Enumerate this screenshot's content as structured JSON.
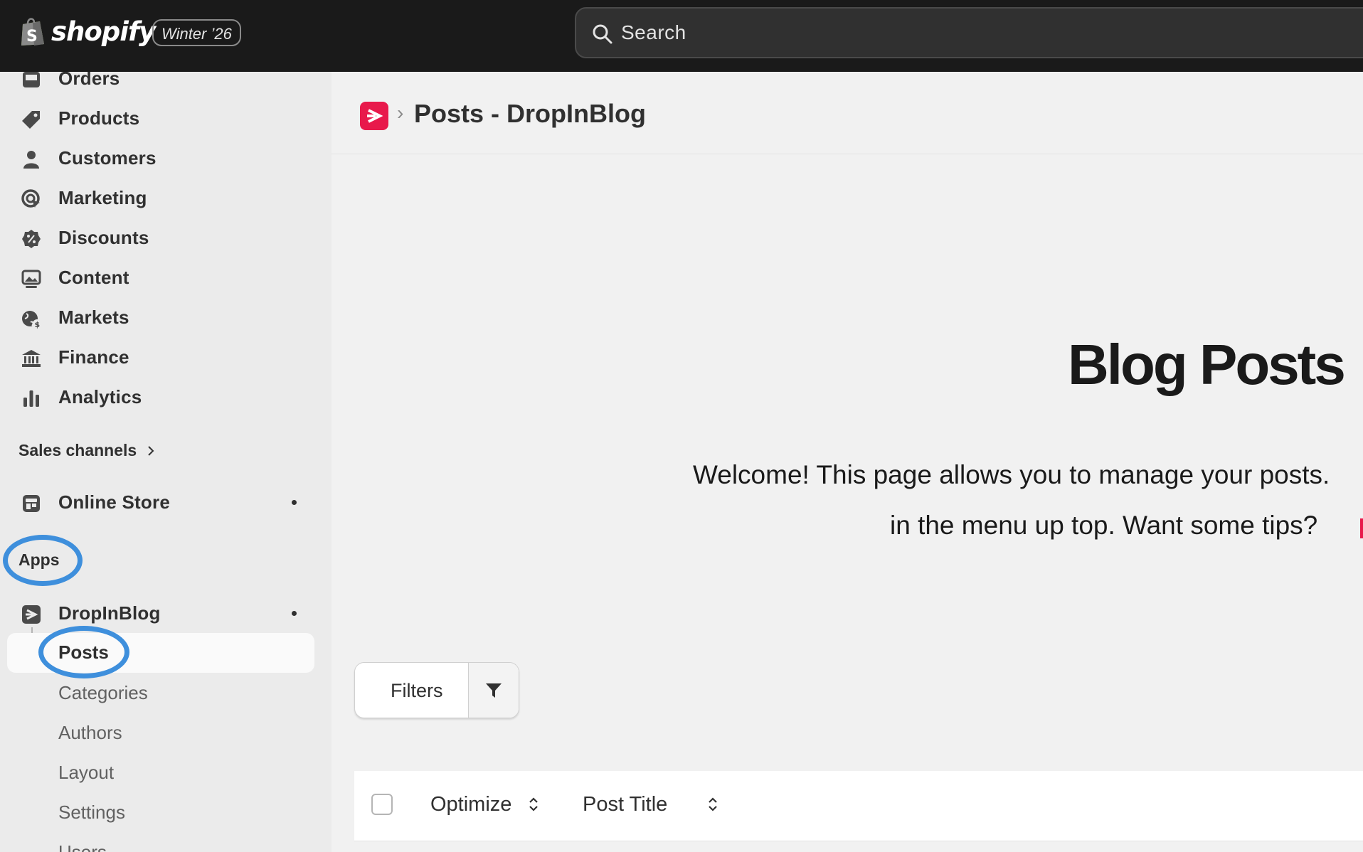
{
  "topbar": {
    "brand": "shopify",
    "edition_badge": "Winter ’26",
    "search_placeholder": "Search"
  },
  "sidebar": {
    "items": [
      {
        "label": "Orders",
        "icon": "inbox-icon"
      },
      {
        "label": "Products",
        "icon": "tag-icon"
      },
      {
        "label": "Customers",
        "icon": "person-icon"
      },
      {
        "label": "Marketing",
        "icon": "target-icon"
      },
      {
        "label": "Discounts",
        "icon": "discount-icon"
      },
      {
        "label": "Content",
        "icon": "image-icon"
      },
      {
        "label": "Markets",
        "icon": "globe-icon"
      },
      {
        "label": "Finance",
        "icon": "bank-icon"
      },
      {
        "label": "Analytics",
        "icon": "bar-chart-icon"
      }
    ],
    "sales_channels": {
      "heading": "Sales channels",
      "items": [
        {
          "label": "Online Store",
          "icon": "store-icon"
        }
      ]
    },
    "apps": {
      "heading": "Apps",
      "app": {
        "label": "DropInBlog",
        "icon": "dropinblog-icon"
      },
      "subitems": [
        "Posts",
        "Categories",
        "Authors",
        "Layout",
        "Settings",
        "Users"
      ],
      "selected": "Posts"
    },
    "highlight_color": "#3e8fdc"
  },
  "main": {
    "breadcrumb_title": "Posts - DropInBlog",
    "heading": "Blog Posts",
    "welcome_line1": "Welcome! This page allows you to manage your posts.",
    "welcome_line2": "in the menu up top. Want some tips?",
    "filters_label": "Filters",
    "table": {
      "columns": [
        "Optimize",
        "Post Title"
      ]
    },
    "accent_color": "#e8194b"
  }
}
